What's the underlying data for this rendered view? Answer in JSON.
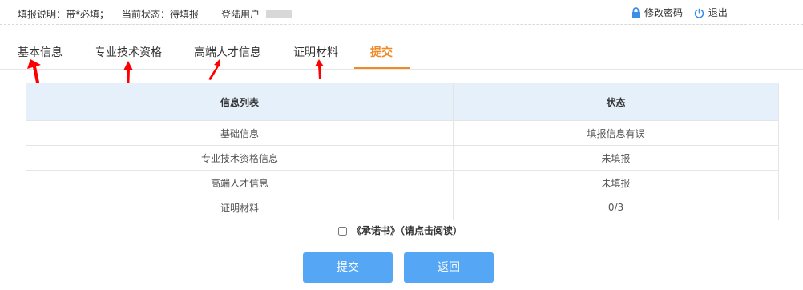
{
  "header": {
    "instructions": "填报说明：带*必填；",
    "status": "当前状态：待填报",
    "user_label": "登陆用户",
    "change_password": "修改密码",
    "logout": "退出"
  },
  "tabs": [
    {
      "label": "基本信息"
    },
    {
      "label": "专业技术资格"
    },
    {
      "label": "高端人才信息"
    },
    {
      "label": "证明材料"
    },
    {
      "label": "提交"
    }
  ],
  "table": {
    "headers": [
      "信息列表",
      "状态"
    ],
    "rows": [
      [
        "基础信息",
        "填报信息有误"
      ],
      [
        "专业技术资格信息",
        "未填报"
      ],
      [
        "高端人才信息",
        "未填报"
      ],
      [
        "证明材料",
        "0/3"
      ]
    ]
  },
  "agreement": {
    "link_text": "《承诺书》",
    "hint": "（请点击阅读）"
  },
  "buttons": {
    "submit": "提交",
    "back": "返回"
  },
  "colors": {
    "accent": "#f08a24",
    "button": "#55a7f5",
    "table_header": "#e6f0fb",
    "annotation_arrow": "#ff0000"
  }
}
